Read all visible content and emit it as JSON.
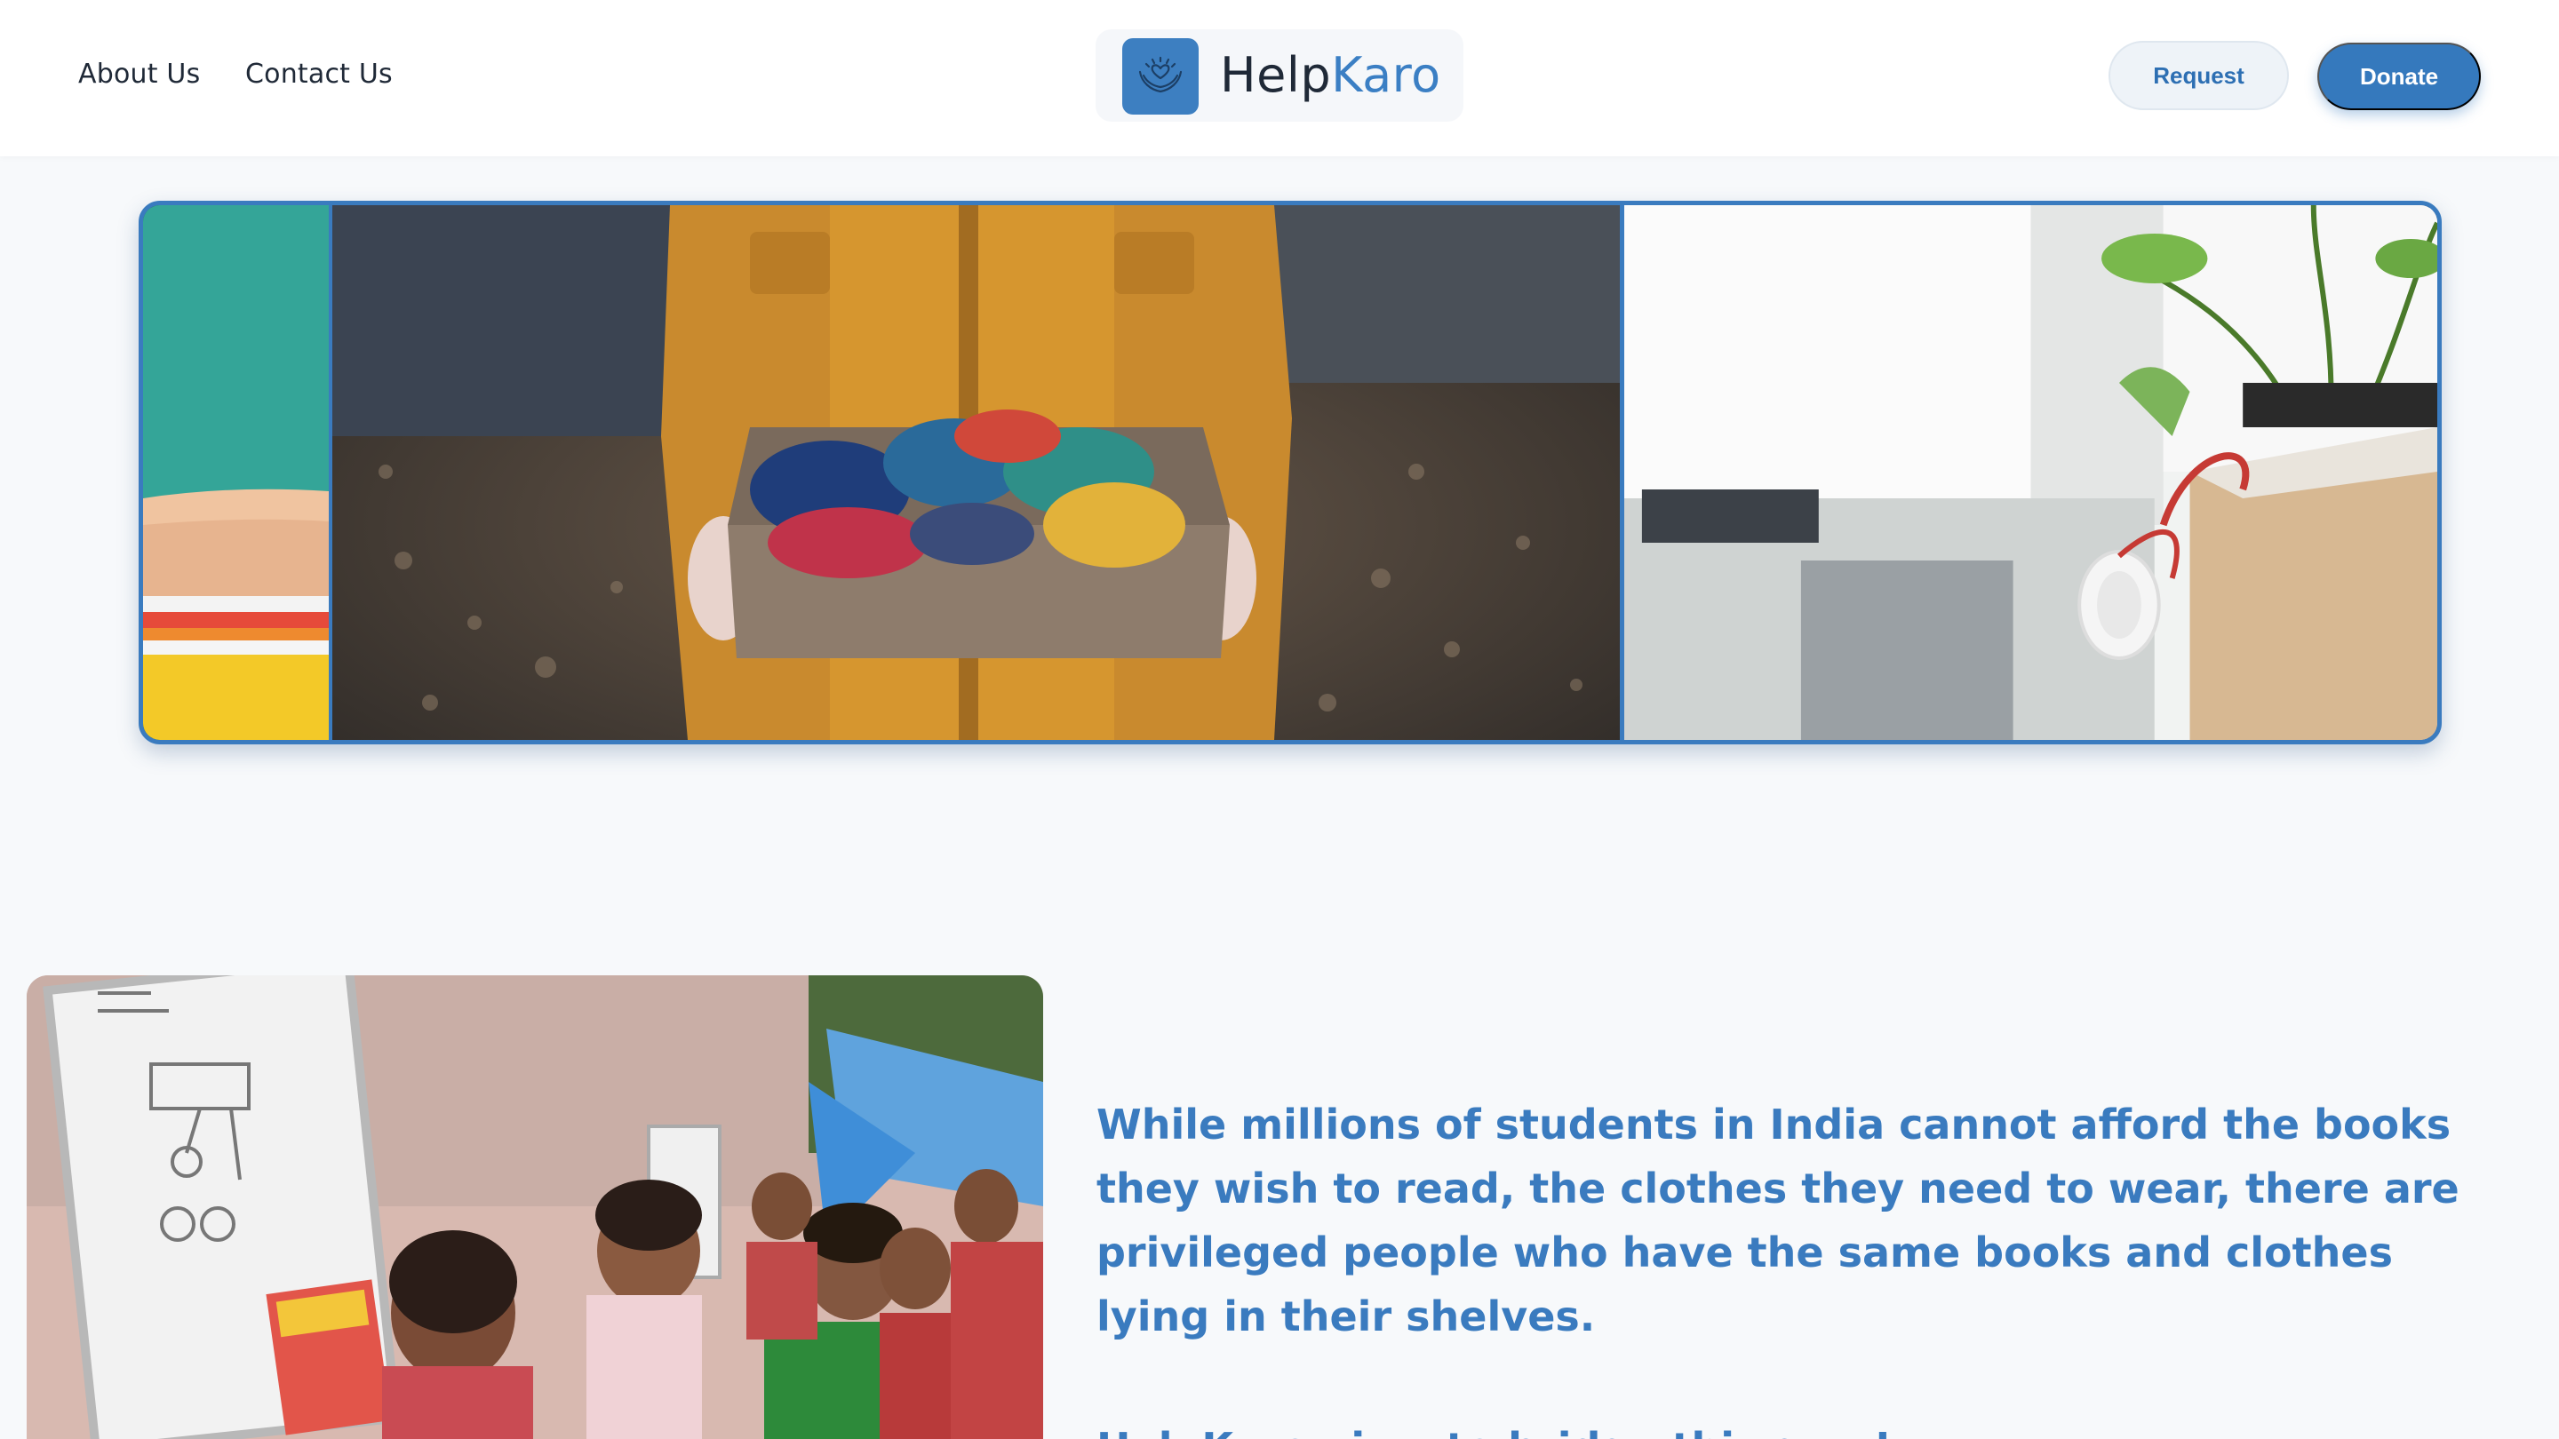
{
  "nav": {
    "about_label": "About Us",
    "contact_label": "Contact Us"
  },
  "brand": {
    "name_part1": "Help",
    "name_part2": "Karo",
    "icon": "hands-heart-icon",
    "accent_color": "#3b7fc4"
  },
  "actions": {
    "request_label": "Request",
    "donate_label": "Donate"
  },
  "carousel": {
    "slides": [
      {
        "icon": "books-photo"
      },
      {
        "icon": "clothes-donation-box-photo"
      },
      {
        "icon": "headphones-desk-photo"
      }
    ]
  },
  "mission": {
    "image_icon": "children-classroom-photo",
    "statement": "While millions of students in India cannot afford the books they wish to read, the clothes they need to wear, there are privileged people who have the same books and clothes lying in their shelves.",
    "tagline": "HelpKaro aims to bridge this gap !"
  },
  "colors": {
    "primary": "#3579bd",
    "text_dark": "#1f2937",
    "background": "#f7f9fb"
  }
}
